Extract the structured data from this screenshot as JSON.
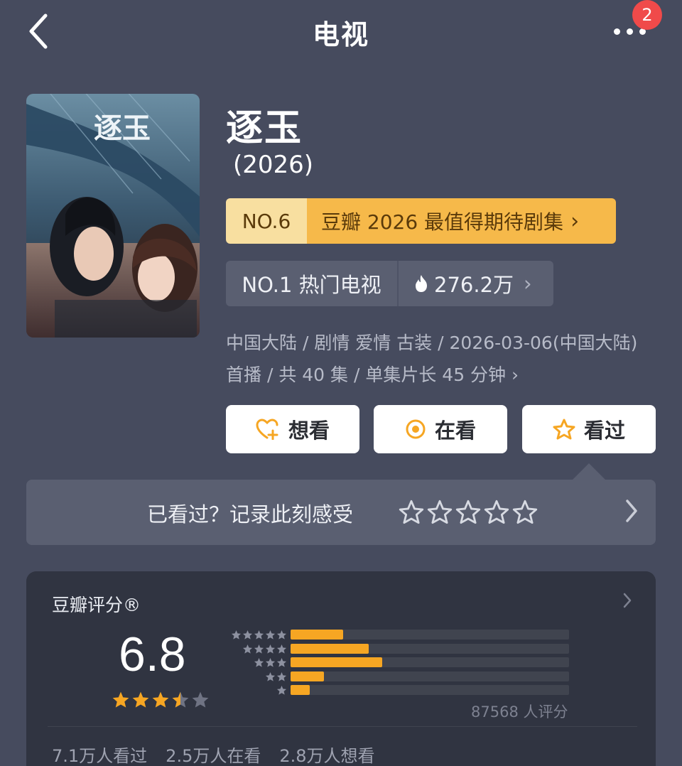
{
  "header": {
    "title": "电视",
    "badge_count": "2",
    "back_icon": "chevron-left-icon",
    "more_icon": "ellipsis-icon"
  },
  "show": {
    "title": "逐玉",
    "year": "(2026)",
    "poster_calligraphy": "逐玉"
  },
  "rank_banner": {
    "number": "NO.6",
    "text": "豆瓣 2026 最值得期待剧集",
    "chevron": "›"
  },
  "hot": {
    "rank_text": "NO.1 热门电视",
    "count": "276.2万",
    "chevron": "›",
    "icon": "flame-icon"
  },
  "info_text": "中国大陆 / 剧情 爱情 古装 / 2026-03-06(中国大陆) 首播 / 共 40 集 / 单集片长 45 分钟",
  "info_chevron": "›",
  "actions": [
    {
      "label": "想看",
      "icon": "heart-plus-icon"
    },
    {
      "label": "在看",
      "icon": "target-icon"
    },
    {
      "label": "看过",
      "icon": "star-outline-icon"
    }
  ],
  "record": {
    "text": "已看过？记录此刻感受",
    "stars": 5,
    "chevron": "›"
  },
  "rating": {
    "label": "豆瓣评分®",
    "score": "6.8",
    "stars_value": 3.5,
    "distribution": [
      {
        "stars": 5,
        "fraction": 0.19
      },
      {
        "stars": 4,
        "fraction": 0.28
      },
      {
        "stars": 3,
        "fraction": 0.33
      },
      {
        "stars": 2,
        "fraction": 0.12
      },
      {
        "stars": 1,
        "fraction": 0.07
      }
    ],
    "count_text": "87568 人评分",
    "stats": [
      "7.1万人看过",
      "2.5万人在看",
      "2.8万人想看"
    ]
  },
  "colors": {
    "accent": "#f6a623",
    "background": "#464b5e",
    "card": "#303441",
    "badge": "#f04a4a"
  }
}
